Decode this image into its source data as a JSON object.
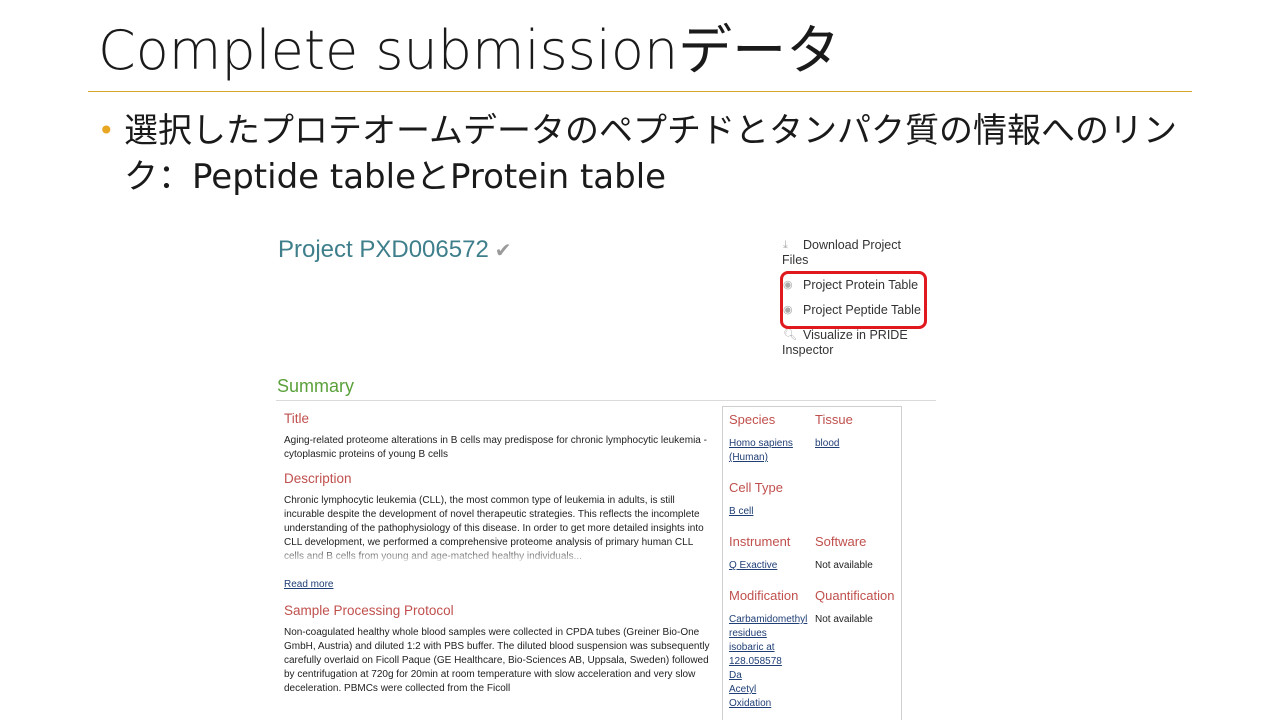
{
  "slide": {
    "title": "Complete submissionデータ",
    "bullet": "選択したプロテオームデータのペプチドとタンパク質の情報へのリンク：Peptide tableとProtein table"
  },
  "project": {
    "title": "Project PXD006572",
    "check_icon": "✔"
  },
  "side_links": {
    "download_line1": "Download Project",
    "download_line2": "Files",
    "protein_table": "Project Protein Table",
    "peptide_table": "Project Peptide Table",
    "visualize_line1": "Visualize in PRIDE",
    "visualize_line2": "Inspector"
  },
  "summary": {
    "heading": "Summary",
    "title_h": "Title",
    "title_text": "Aging-related proteome alterations in B cells may predispose for chronic lymphocytic leukemia - cytoplasmic proteins of young B cells",
    "description_h": "Description",
    "description_text": "Chronic lymphocytic leukemia (CLL), the most common type of leukemia in adults, is still incurable despite the development of novel therapeutic strategies. This reflects the incomplete understanding of the pathophysiology of this disease. In order to get more detailed insights into CLL development, we performed a comprehensive proteome analysis of primary human CLL cells and B cells from young and age-matched healthy individuals...",
    "read_more": "Read more",
    "sample_h": "Sample Processing Protocol",
    "sample_text": "Non-coagulated healthy whole blood samples were collected in CPDA tubes (Greiner Bio-One GmbH, Austria) and diluted 1:2 with PBS buffer. The diluted blood suspension was subsequently carefully overlaid on Ficoll Paque (GE Healthcare, Bio-Sciences AB, Uppsala, Sweden) followed by centrifugation at 720g for 20min at room temperature with slow acceleration and very slow deceleration. PBMCs were collected from the Ficoll"
  },
  "meta": {
    "species_h": "Species",
    "species_v1": "Homo sapiens",
    "species_v2": "(Human)",
    "tissue_h": "Tissue",
    "tissue_v": "blood",
    "celltype_h": "Cell Type",
    "celltype_v": "B cell",
    "instrument_h": "Instrument",
    "instrument_v": "Q Exactive",
    "software_h": "Software",
    "software_v": "Not available",
    "modification_h": "Modification",
    "mod_v1": "Carbamidomethyl",
    "mod_v2": "residues",
    "mod_v3": "isobaric at",
    "mod_v4": "128.058578",
    "mod_v5": "Da",
    "mod_v6": "Acetyl",
    "mod_v7": "Oxidation",
    "quant_h": "Quantification",
    "quant_v": "Not available"
  },
  "colors": {
    "accent_rule": "#d9a52b",
    "bullet": "#e8a623",
    "project_title": "#3f7f8c",
    "summary": "#5aa13b",
    "section_heading": "#c0504d",
    "link": "#1f3e75",
    "highlight_box": "#e0191f"
  }
}
